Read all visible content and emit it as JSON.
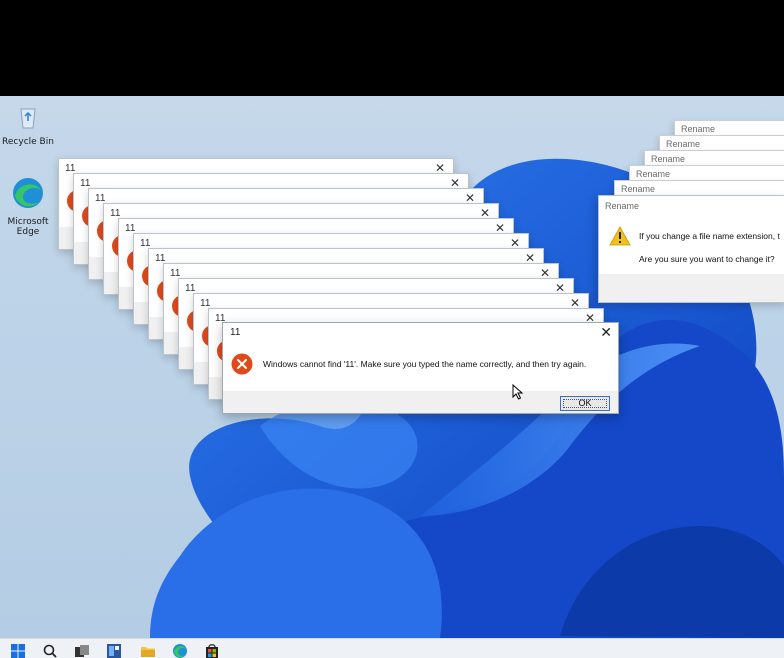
{
  "desktop": {
    "icons": [
      {
        "label": "Recycle Bin"
      },
      {
        "label": "Microsoft Edge"
      }
    ]
  },
  "error_dialog": {
    "title": "11",
    "message": "Windows cannot find '11'. Make sure you typed the name correctly, and then try again.",
    "ok_label": "OK",
    "close_glyph": "✕",
    "icon": "error-icon"
  },
  "stacked_errors": {
    "title": "11",
    "close_glyph": "✕"
  },
  "rename_dialog": {
    "title": "Rename",
    "line1": "If you change a file name extension, t",
    "line2": "Are you sure you want to change it?",
    "icon": "warning-icon"
  },
  "rename_stack": {
    "title": "Rename"
  },
  "taskbar": {
    "icons": [
      "start-icon",
      "search-icon",
      "task-view-icon",
      "widgets-icon",
      "file-explorer-icon",
      "edge-icon",
      "store-icon"
    ]
  },
  "colors": {
    "error_red": "#e04a1b",
    "wallpaper_blue": "#1a5bd8",
    "warning_yellow": "#f2c018",
    "ok_focus": "#3c6fc4"
  }
}
